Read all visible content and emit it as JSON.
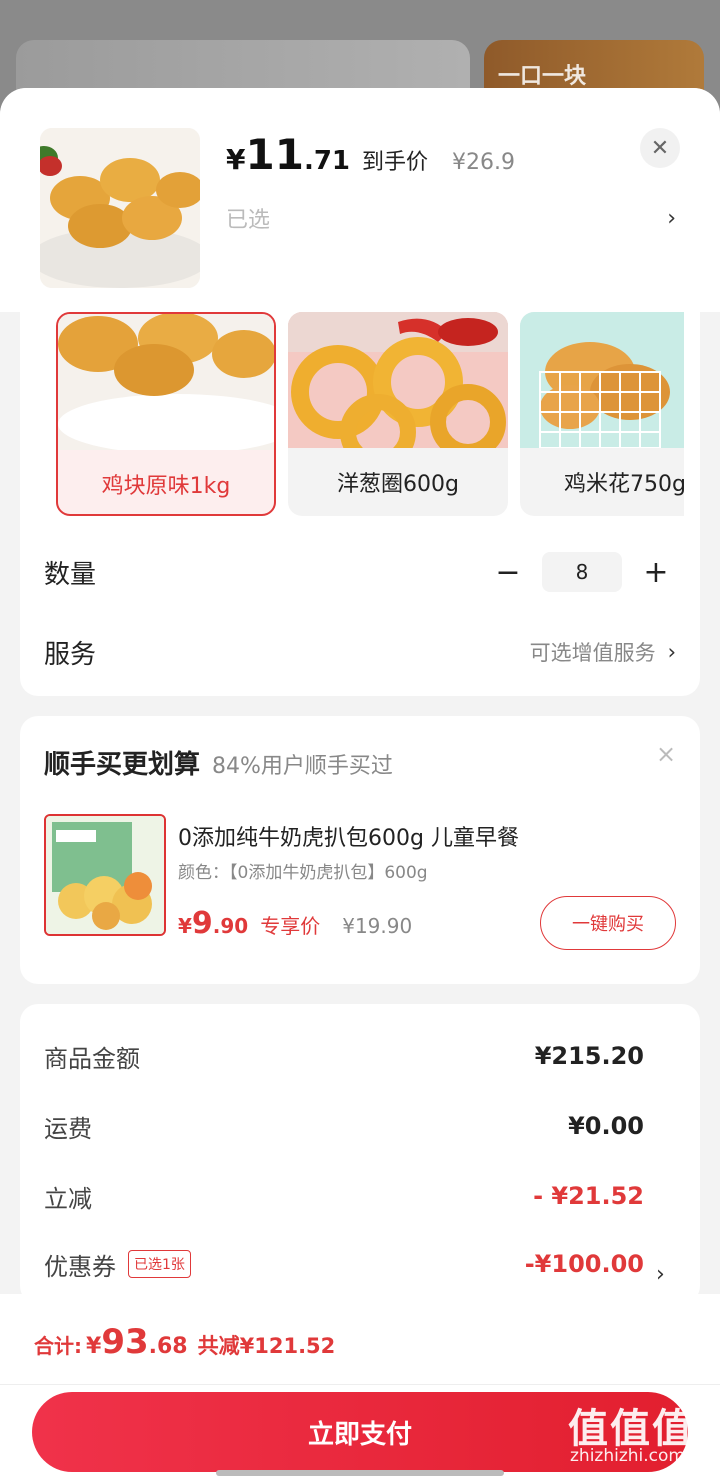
{
  "background": {
    "promo_text": "一口一块"
  },
  "product": {
    "price_symbol": "¥",
    "price_int": "11",
    "price_dec": ".71",
    "price_label": "到手价",
    "original_price": "¥26.9",
    "selected_text": "已选",
    "close_icon": "close-icon"
  },
  "variants": [
    {
      "label": "鸡块原味1kg",
      "selected": true
    },
    {
      "label": "洋葱圈600g",
      "selected": false
    },
    {
      "label": "鸡米花750g",
      "selected": false
    }
  ],
  "quantity": {
    "label": "数量",
    "minus": "−",
    "value": "8",
    "plus": "+"
  },
  "service": {
    "label": "服务",
    "value": "可选增值服务",
    "chevron": "›"
  },
  "upsell": {
    "title": "顺手买更划算",
    "subtitle": "84%用户顺手买过",
    "close": "×",
    "product_name": "0添加纯牛奶虎扒包600g 儿童早餐",
    "spec": "颜色：【0添加牛奶虎扒包】600g",
    "price_symbol": "¥",
    "price_int": "9",
    "price_dec": ".90",
    "price_label": "专享价",
    "original_price": "¥19.90",
    "buy_button": "一键购买"
  },
  "summary": {
    "rows": [
      {
        "label": "商品金额",
        "value": "¥215.20",
        "red": false
      },
      {
        "label": "运费",
        "value": "¥0.00",
        "red": false
      },
      {
        "label": "立减",
        "value": "- ¥21.52",
        "red": true
      },
      {
        "label": "优惠券",
        "value": "-¥100.00",
        "red": true,
        "tag": "已选1张"
      }
    ]
  },
  "bottom": {
    "total_label": "合计:",
    "total_symbol": "¥",
    "total_int": "93",
    "total_dec": ".68",
    "total_saved": "共减¥121.52",
    "pay_button": "立即支付"
  },
  "watermark": {
    "big": "值值值",
    "small": "zhizhizhi.com"
  },
  "colors": {
    "accent": "#e0393a"
  }
}
